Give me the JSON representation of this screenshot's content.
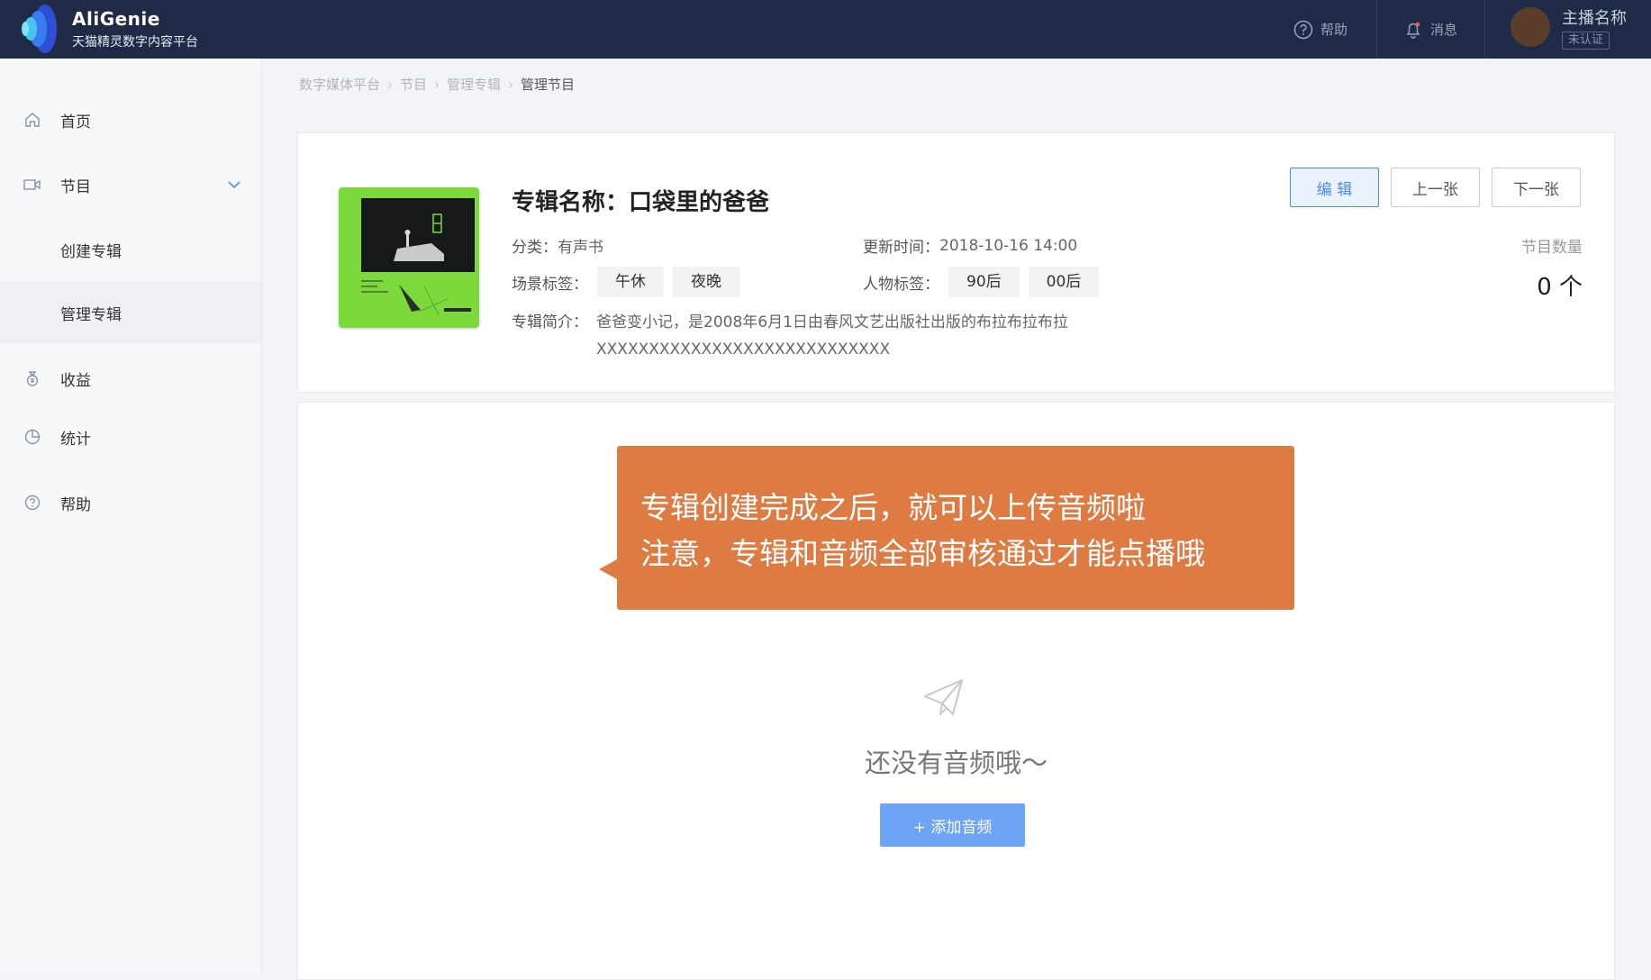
{
  "brand": {
    "name": "AliGenie",
    "subtitle": "天猫精灵数字内容平台"
  },
  "topbar": {
    "help_label": "帮助",
    "messages_label": "消息",
    "anchor_name": "主播名称",
    "verification_status": "未认证"
  },
  "sidebar": {
    "items": [
      {
        "label": "首页",
        "icon": "home-icon"
      },
      {
        "label": "节目",
        "icon": "video-icon"
      },
      {
        "label": "创建专辑"
      },
      {
        "label": "管理专辑"
      },
      {
        "label": "收益",
        "icon": "money-bag-icon"
      },
      {
        "label": "统计",
        "icon": "pie-chart-icon"
      },
      {
        "label": "帮助",
        "icon": "help-icon"
      }
    ]
  },
  "breadcrumb": [
    "数字媒体平台",
    "节目",
    "管理专辑",
    "管理节目"
  ],
  "album": {
    "title": "专辑名称：口袋里的爸爸",
    "category_label": "分类：",
    "category_value": "有声书",
    "updated_label": "更新时间：",
    "updated_value": "2018-10-16  14:00",
    "scene_tags_label": "场景标签：",
    "scene_tags": [
      "午休",
      "夜晚"
    ],
    "people_tags_label": "人物标签：",
    "people_tags": [
      "90后",
      "00后"
    ],
    "intro_label": "专辑简介：",
    "intro_line1": "爸爸变小记，是2008年6月1日由春风文艺出版社出版的布拉布拉布拉",
    "intro_line2": "XXXXXXXXXXXXXXXXXXXXXXXXXXXX",
    "count_label": "节目数量",
    "count_value": "0 个",
    "buttons": {
      "edit": "编 辑",
      "prev": "上一张",
      "next": "下一张"
    }
  },
  "audio": {
    "empty_text": "还没有音频哦～",
    "add_button": "+ 添加音频"
  },
  "tooltip": {
    "line1": "专辑创建完成之后，就可以上传音频啦",
    "line2": "注意，专辑和音频全部审核通过才能点播哦"
  },
  "colors": {
    "topbar_bg": "#1f2a47",
    "accent_blue": "#4a8af4",
    "tooltip_orange": "#de7b43",
    "cover_green": "#7bd93b"
  }
}
